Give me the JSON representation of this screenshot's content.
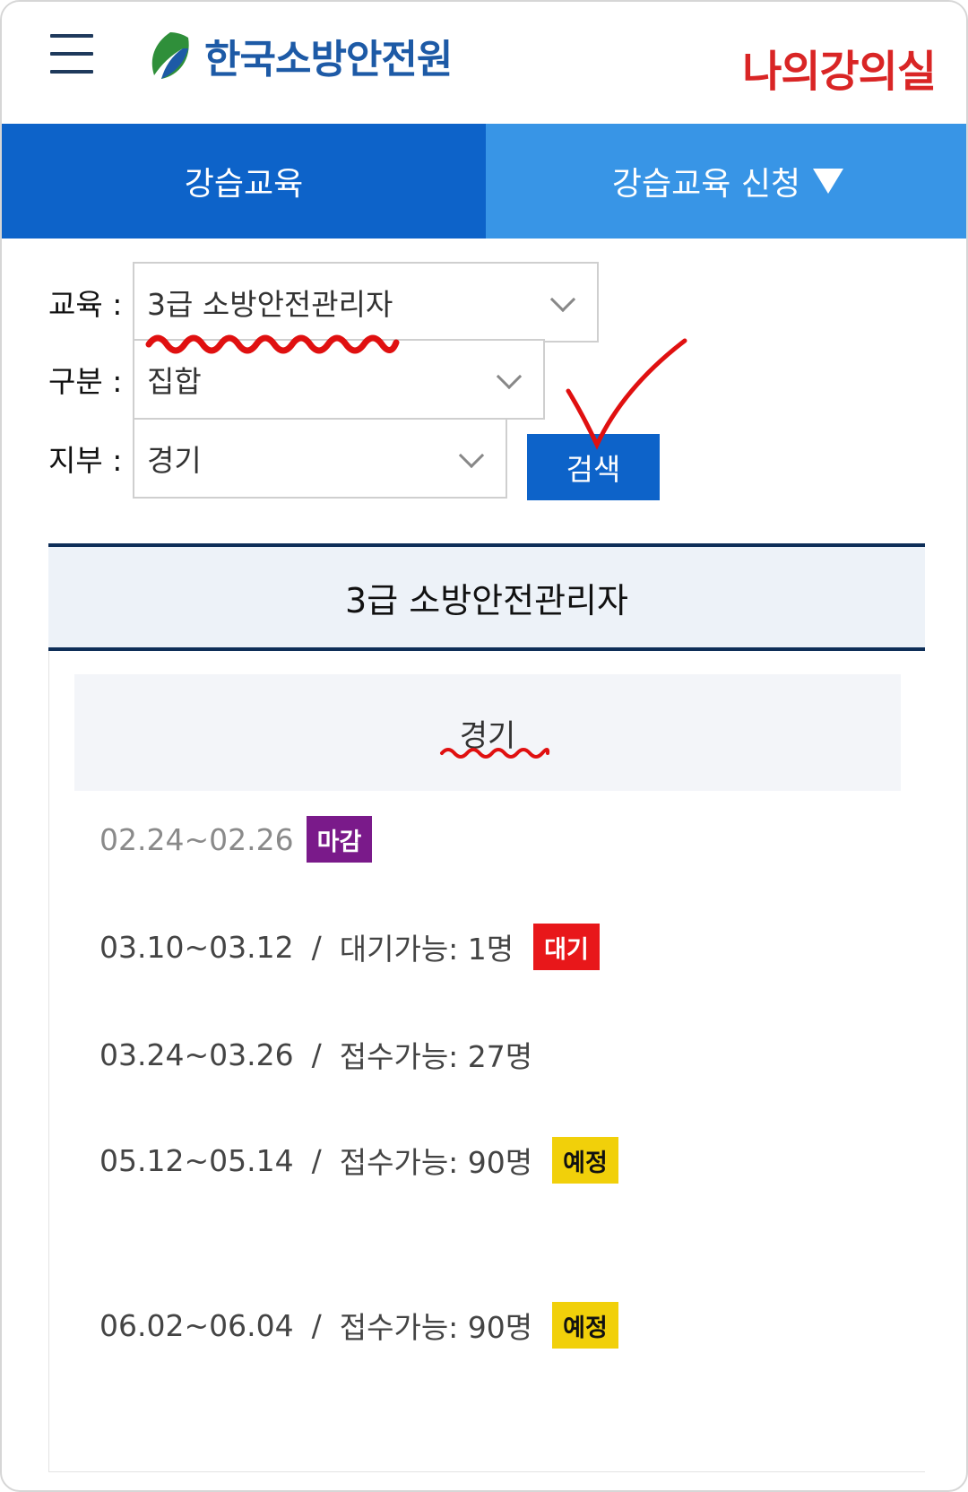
{
  "header": {
    "logo_text": "한국소방안전원",
    "classroom_label": "나의강의실"
  },
  "tabs": [
    {
      "label": "강습교육"
    },
    {
      "label": "강습교육 신청"
    }
  ],
  "filters": {
    "education_label": "교육 :",
    "education_value": "3급 소방안전관리자",
    "type_label": "구분 :",
    "type_value": "집합",
    "branch_label": "지부 :",
    "branch_value": "경기",
    "search_label": "검색"
  },
  "results": {
    "title": "3급 소방안전관리자",
    "region": "경기",
    "schedules": [
      {
        "date": "02.24~02.26",
        "availability": "",
        "badge": "마감"
      },
      {
        "date": "03.10~03.12",
        "availability": "대기가능: 1명",
        "badge": "대기"
      },
      {
        "date": "03.24~03.26",
        "availability": "접수가능: 27명",
        "badge": ""
      },
      {
        "date": "05.12~05.14",
        "availability": "접수가능: 90명",
        "badge": "예정"
      },
      {
        "date": "06.02~06.04",
        "availability": "접수가능: 90명",
        "badge": "예정"
      }
    ]
  },
  "colors": {
    "brand_blue": "#0d63c9",
    "tab_light_blue": "#3895e6",
    "classroom_red": "#d92525",
    "badge_closed": "#7a1a8a",
    "badge_wait": "#e8171a",
    "badge_planned": "#f1d00a",
    "annotation_red": "#e01010"
  }
}
